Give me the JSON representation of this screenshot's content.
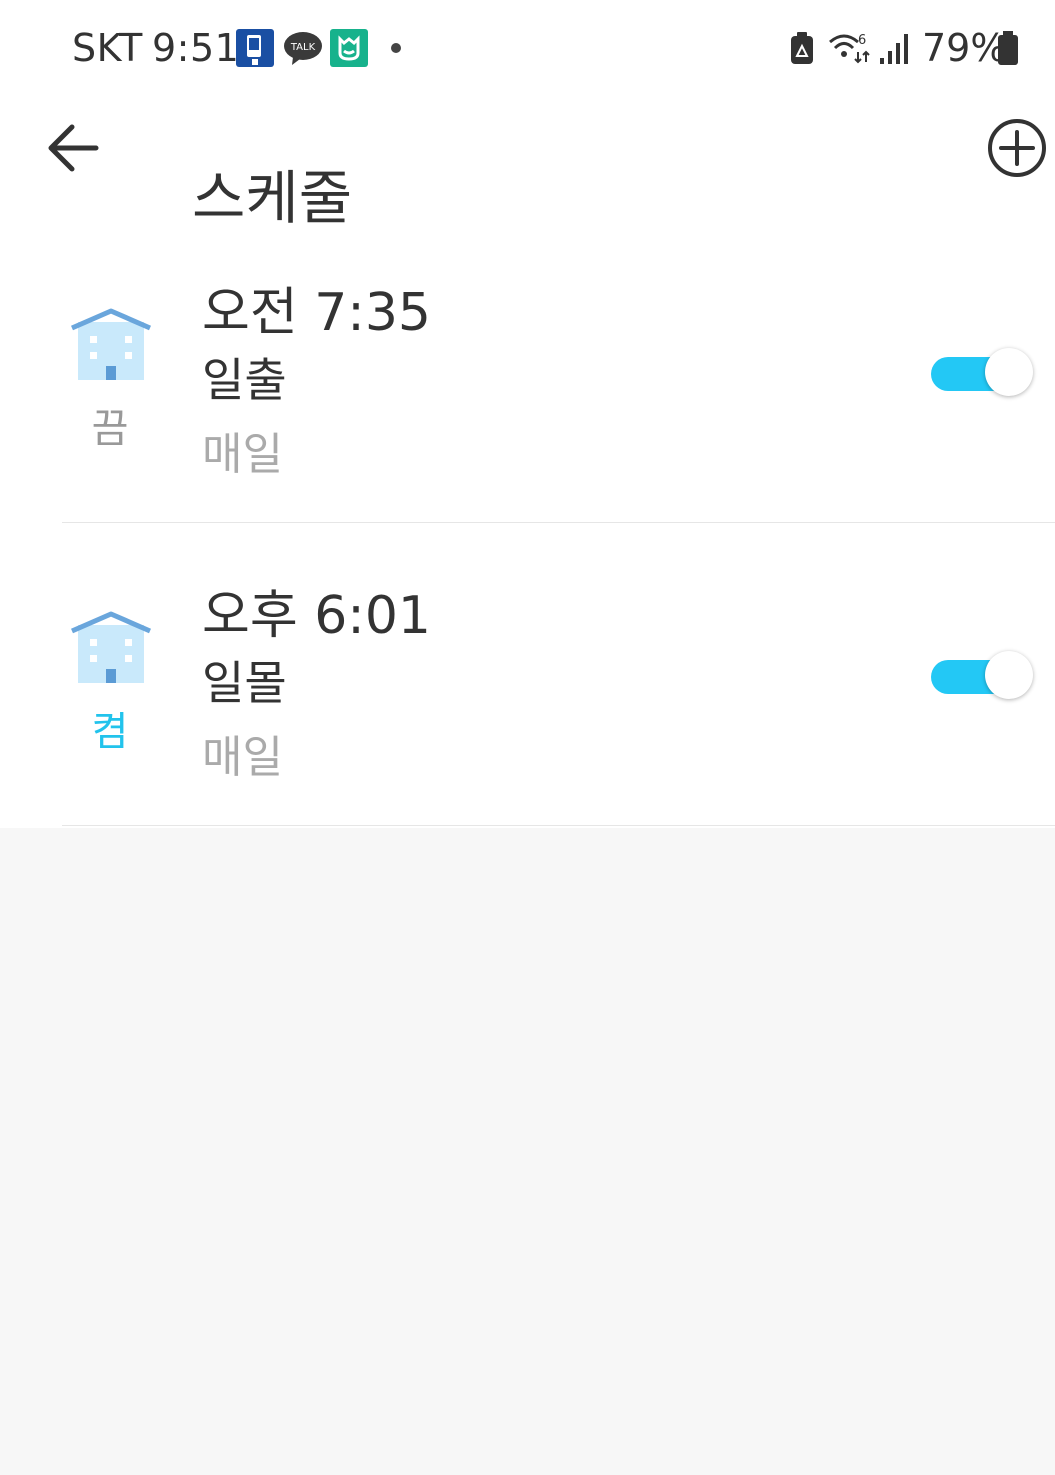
{
  "status_bar": {
    "carrier": "SKT",
    "time": "9:51",
    "notifications": [
      "app-notification-icon",
      "kakaotalk-icon",
      "mi-home-icon",
      "more-dot"
    ],
    "talk_label": "TALK",
    "battery_percent": "79%"
  },
  "app_bar": {
    "title": "스케줄",
    "back_icon": "arrow-left-icon",
    "add_icon": "plus-circle-icon"
  },
  "schedules": [
    {
      "time": "오전 7:35",
      "name": "일출",
      "repeat": "매일",
      "state": "끔",
      "enabled": true
    },
    {
      "time": "오후 6:01",
      "name": "일몰",
      "repeat": "매일",
      "state": "켬",
      "enabled": true
    }
  ],
  "colors": {
    "accent": "#23c8f5",
    "state_on": "#22c3ec",
    "state_off": "#999999",
    "background": "#f7f7f7"
  }
}
